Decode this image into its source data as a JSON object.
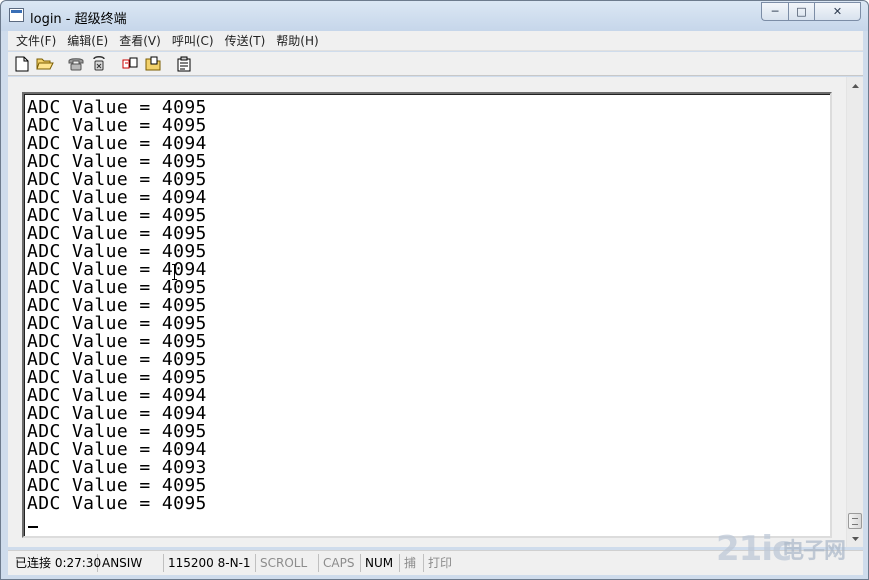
{
  "window": {
    "title": "login - 超级终端",
    "buttons": {
      "minimize": "─",
      "maximize": "□",
      "close": "✕"
    }
  },
  "menu": [
    "文件(F)",
    "编辑(E)",
    "查看(V)",
    "呼叫(C)",
    "传送(T)",
    "帮助(H)"
  ],
  "toolbar": [
    {
      "icon": "new-file-icon"
    },
    {
      "icon": "open-folder-icon"
    },
    {
      "icon": "call-phone-icon"
    },
    {
      "icon": "disconnect-icon"
    },
    {
      "icon": "send-file-icon"
    },
    {
      "icon": "receive-file-icon"
    },
    {
      "icon": "properties-icon"
    }
  ],
  "terminal": {
    "lines": [
      "ADC Value = 4095",
      "ADC Value = 4095",
      "ADC Value = 4094",
      "ADC Value = 4095",
      "ADC Value = 4095",
      "ADC Value = 4094",
      "ADC Value = 4095",
      "ADC Value = 4095",
      "ADC Value = 4095",
      "ADC Value = 4094",
      "ADC Value = 4095",
      "ADC Value = 4095",
      "ADC Value = 4095",
      "ADC Value = 4095",
      "ADC Value = 4095",
      "ADC Value = 4095",
      "ADC Value = 4094",
      "ADC Value = 4094",
      "ADC Value = 4095",
      "ADC Value = 4094",
      "ADC Value = 4093",
      "ADC Value = 4095",
      "ADC Value = 4095"
    ]
  },
  "status": {
    "connection": "已连接 0:27:30",
    "emulation": "ANSIW",
    "settings": "115200 8-N-1",
    "scroll": "SCROLL",
    "caps": "CAPS",
    "num": "NUM",
    "capture": "捕",
    "print": "打印"
  },
  "watermark": {
    "logo": "21ic",
    "text": "电子网"
  }
}
